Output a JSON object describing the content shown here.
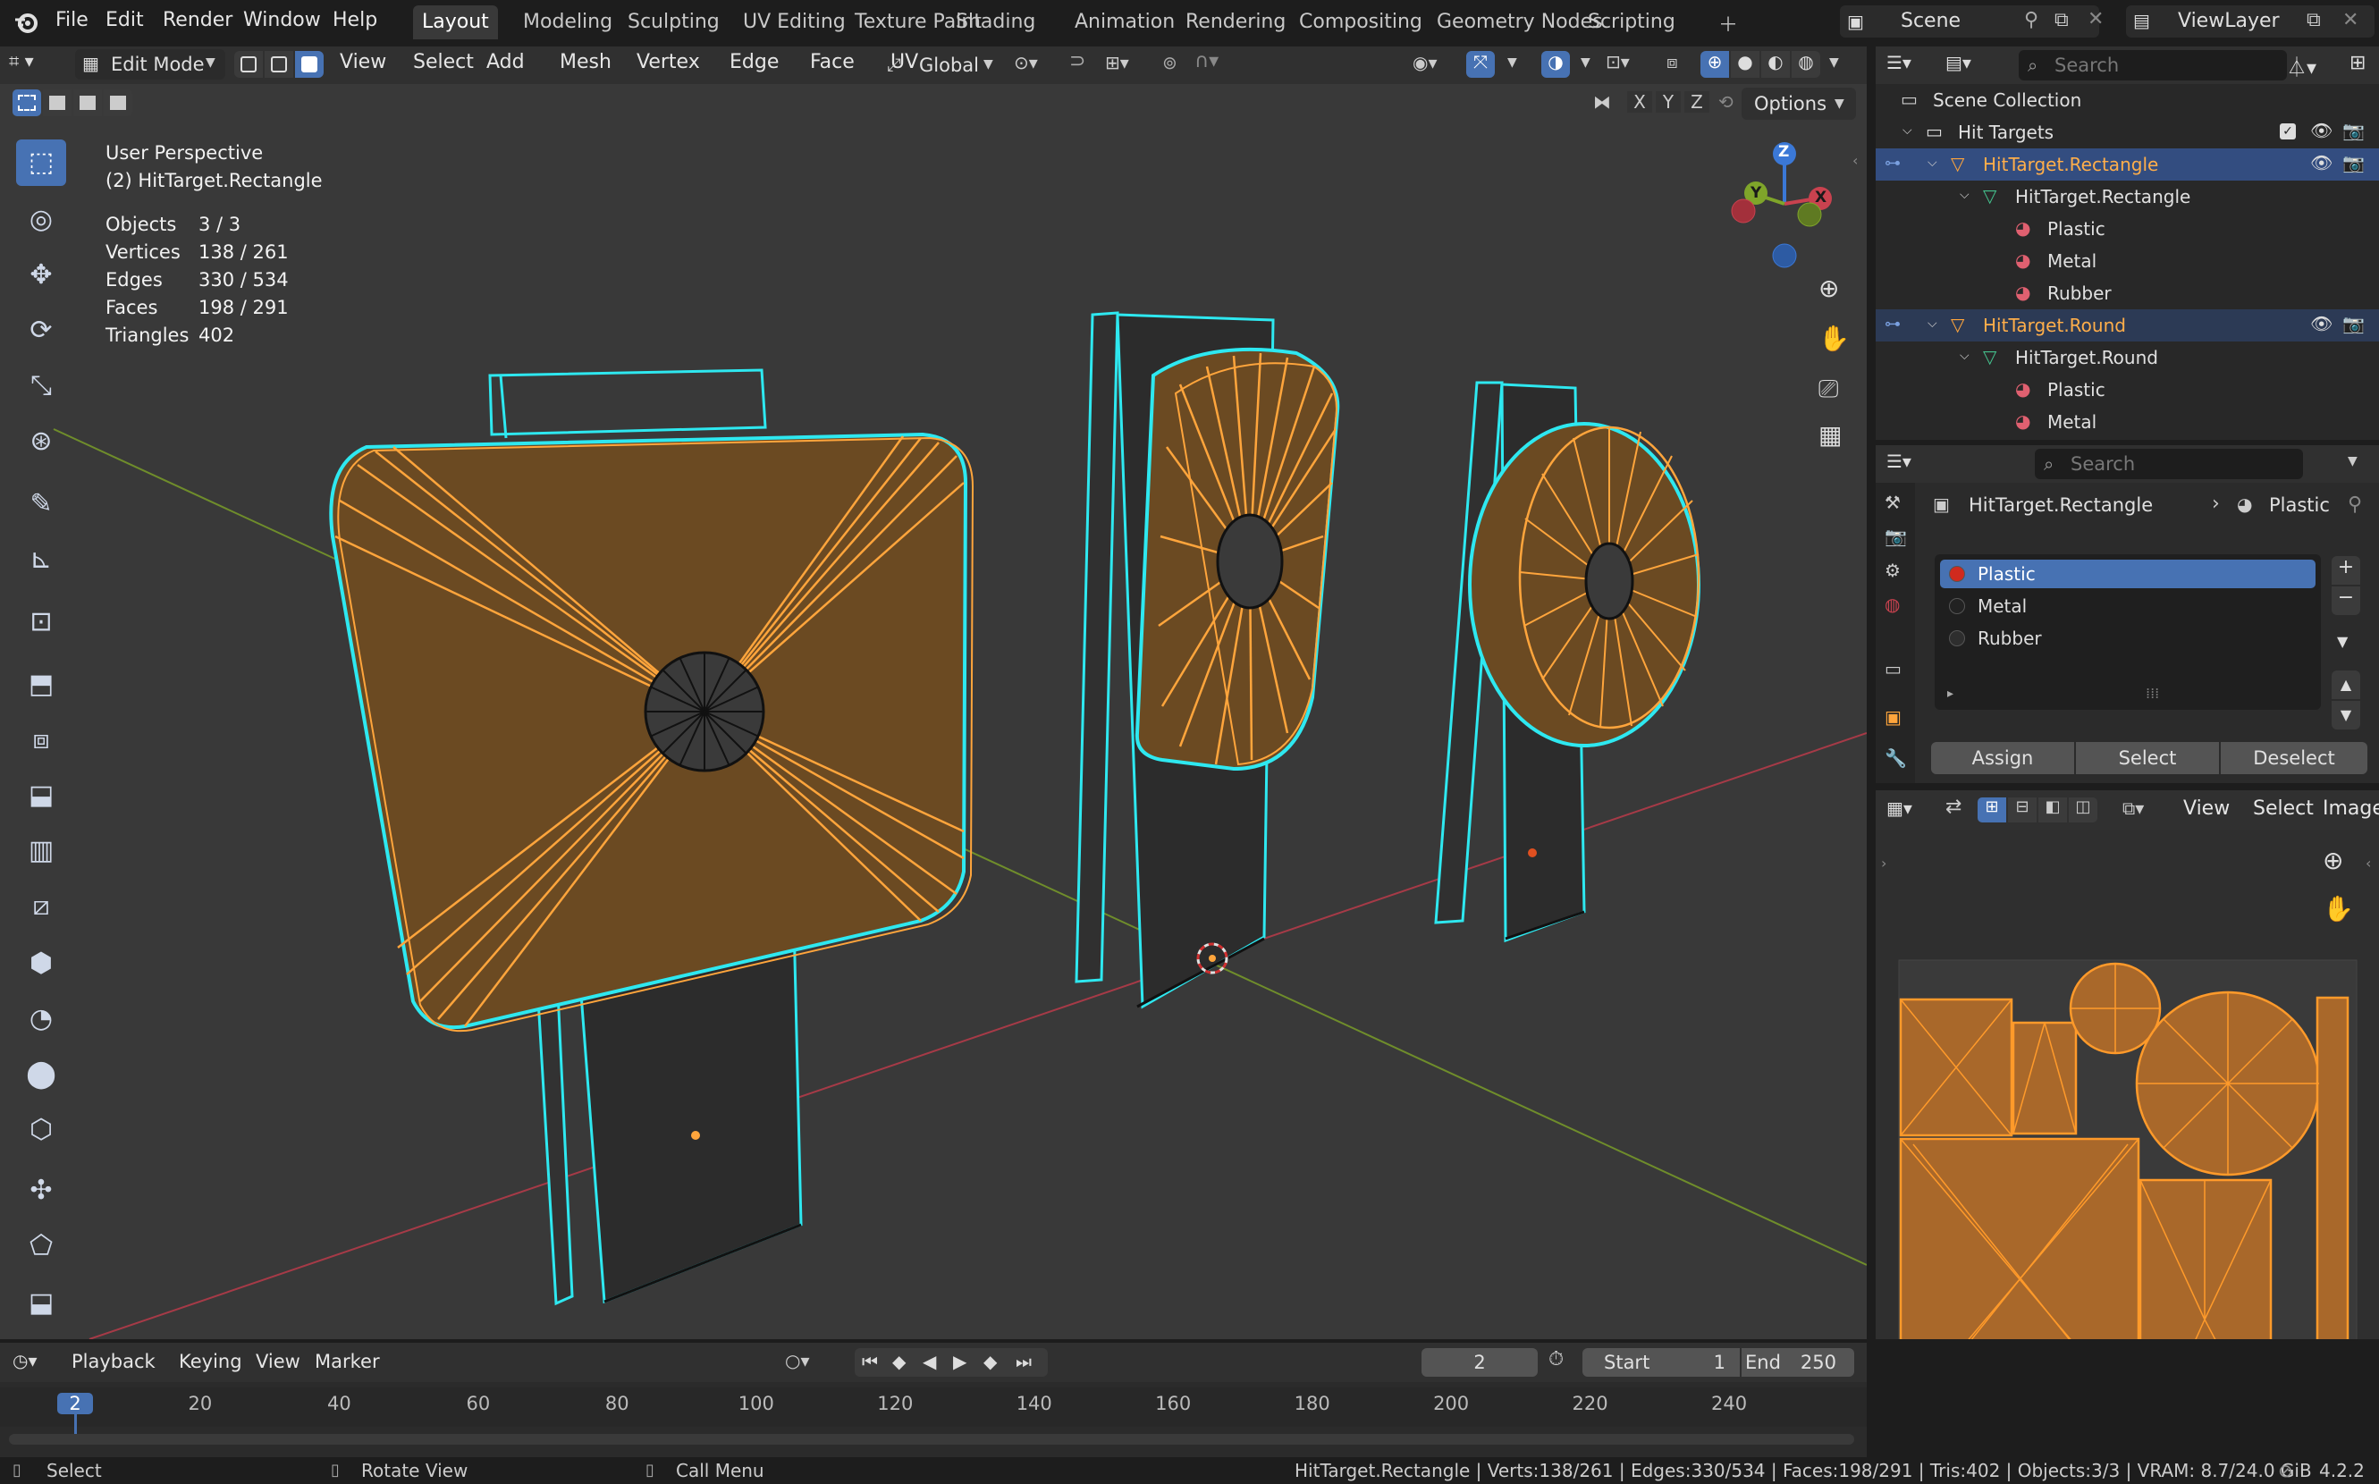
{
  "topbar": {
    "menus": [
      "File",
      "Edit",
      "Render",
      "Window",
      "Help"
    ],
    "workspaces": [
      "Layout",
      "Modeling",
      "Sculpting",
      "UV Editing",
      "Texture Paint",
      "Shading",
      "Animation",
      "Rendering",
      "Compositing",
      "Geometry Nodes",
      "Scripting"
    ],
    "active_workspace": "Layout",
    "scene": "Scene",
    "view_layer": "ViewLayer"
  },
  "viewport_header": {
    "mode": "Edit Mode",
    "menus": [
      "View",
      "Select",
      "Add",
      "Mesh",
      "Vertex",
      "Edge",
      "Face",
      "UV"
    ],
    "transform_orientation": "Global",
    "options_label": "Options",
    "axes": [
      "X",
      "Y",
      "Z"
    ]
  },
  "overlay": {
    "perspective": "User Perspective",
    "object": "(2) HitTarget.Rectangle",
    "stats": [
      {
        "label": "Objects",
        "value": "3 / 3"
      },
      {
        "label": "Vertices",
        "value": "138 / 261"
      },
      {
        "label": "Edges",
        "value": "330 / 534"
      },
      {
        "label": "Faces",
        "value": "198 / 291"
      },
      {
        "label": "Triangles",
        "value": "402"
      }
    ]
  },
  "gizmo": {
    "x": "X",
    "y": "Y",
    "z": "Z"
  },
  "outliner": {
    "search_placeholder": "Search",
    "rows": [
      {
        "label": "Scene Collection",
        "type": "scene"
      },
      {
        "label": "Hit Targets",
        "type": "collection"
      },
      {
        "label": "HitTarget.Rectangle",
        "type": "object"
      },
      {
        "label": "HitTarget.Rectangle",
        "type": "mesh"
      },
      {
        "label": "Plastic",
        "type": "material"
      },
      {
        "label": "Metal",
        "type": "material"
      },
      {
        "label": "Rubber",
        "type": "material"
      },
      {
        "label": "HitTarget.Round",
        "type": "object"
      },
      {
        "label": "HitTarget.Round",
        "type": "mesh"
      },
      {
        "label": "Plastic",
        "type": "material"
      },
      {
        "label": "Metal",
        "type": "material"
      }
    ]
  },
  "properties": {
    "search_placeholder": "Search",
    "breadcrumb_object": "HitTarget.Rectangle",
    "breadcrumb_material": "Plastic",
    "slots": [
      "Plastic",
      "Metal",
      "Rubber"
    ],
    "active_slot": "Plastic",
    "assign": "Assign",
    "select": "Select",
    "deselect": "Deselect"
  },
  "uv_editor": {
    "menus": [
      "View",
      "Select",
      "Image"
    ]
  },
  "timeline": {
    "menus": [
      "Playback",
      "Keying",
      "View",
      "Marker"
    ],
    "current_frame": "2",
    "start_label": "Start",
    "start": "1",
    "end_label": "End",
    "end": "250",
    "ticks": [
      "2",
      "20",
      "40",
      "60",
      "80",
      "100",
      "120",
      "140",
      "160",
      "180",
      "200",
      "220",
      "240"
    ]
  },
  "statusbar": {
    "select": "Select",
    "rotate": "Rotate View",
    "call_menu": "Call Menu",
    "info": "HitTarget.Rectangle | Verts:138/261 | Edges:330/534 | Faces:198/291 | Tris:402 | Objects:3/3 | VRAM: 8.7/24.0 GiB",
    "version": "4.2.2"
  },
  "colors": {
    "accent": "#4772b3",
    "selection_orange": "#ffa53c",
    "edge_cyan": "#2ee8f0",
    "face_fill": "#6b4a22",
    "x_axis": "#c9424f",
    "y_axis": "#7fa52a",
    "z_axis": "#3b78d6"
  }
}
